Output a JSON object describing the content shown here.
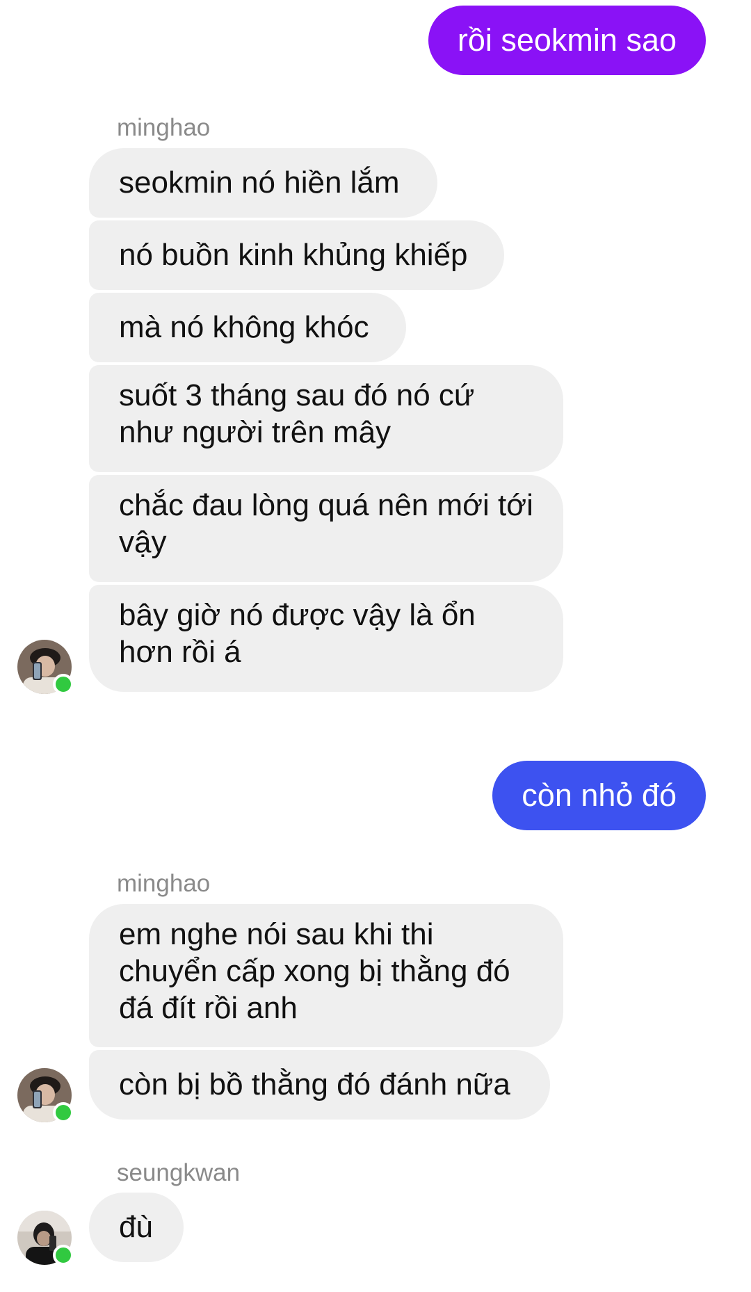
{
  "colors": {
    "outgoing_purple": "#8a12f6",
    "outgoing_blue": "#3d52f0",
    "incoming_bubble": "#efefef",
    "online_dot": "#31c940"
  },
  "messages": {
    "out_1": "rồi seokmin sao",
    "group_1": {
      "sender": "minghao",
      "lines": [
        "seokmin nó hiền lắm",
        "nó buồn kinh khủng khiếp",
        "mà nó không khóc",
        "suốt 3 tháng sau đó nó cứ như người trên mây",
        "chắc đau lòng quá nên mới tới vậy",
        "bây giờ nó được vậy là ổn hơn rồi á"
      ]
    },
    "out_2": "còn nhỏ đó",
    "group_2": {
      "sender": "minghao",
      "lines": [
        "em nghe nói sau khi thi chuyển cấp xong bị thằng đó đá đít rồi anh",
        "còn bị bồ thằng đó đánh nữa"
      ]
    },
    "group_3": {
      "sender": "seungkwan",
      "lines": [
        "đù"
      ]
    }
  },
  "avatars": {
    "minghao": "avatar-minghao",
    "seungkwan": "avatar-seungkwan"
  }
}
